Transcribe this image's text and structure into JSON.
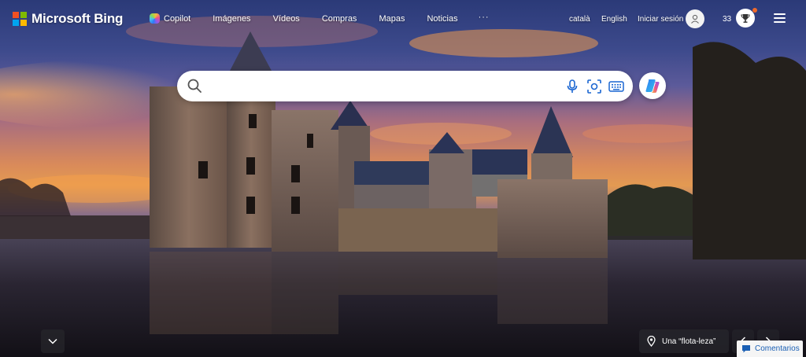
{
  "brand": {
    "name": "Microsoft Bing",
    "colors": {
      "red": "#f25022",
      "green": "#7fba00",
      "blue": "#00a4ef",
      "yellow": "#ffb900"
    }
  },
  "nav": {
    "items": [
      {
        "label": "Copilot",
        "icon": "copilot-icon"
      },
      {
        "label": "Imágenes"
      },
      {
        "label": "Vídeos"
      },
      {
        "label": "Compras"
      },
      {
        "label": "Mapas"
      },
      {
        "label": "Noticias"
      }
    ],
    "more": "···"
  },
  "header_right": {
    "lang_1": "català",
    "lang_2": "English",
    "sign_in": "Iniciar sesión",
    "rewards_count": "33",
    "reward_dot_color": "#f06a2a"
  },
  "search": {
    "value": "",
    "placeholder": "",
    "icons": [
      "search-icon",
      "microphone-icon",
      "visual-search-icon",
      "keyboard-icon"
    ]
  },
  "copilot_button": {
    "icon": "copilot-icon"
  },
  "image_info": {
    "title": "Una “flota-leza”",
    "icon": "location-pin-icon"
  },
  "feedback": {
    "label": "Comentarios",
    "color": "#1a5fb4"
  }
}
